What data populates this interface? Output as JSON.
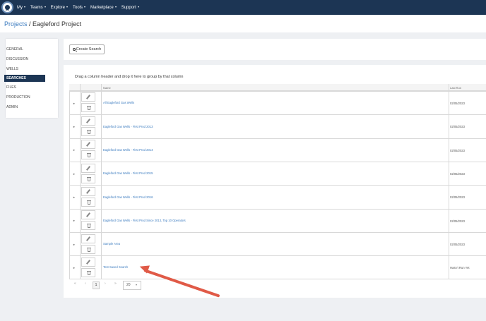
{
  "nav": {
    "logo_text": "BIG",
    "items": [
      "My",
      "Teams",
      "Explore",
      "Tools",
      "Marketplace",
      "Support"
    ]
  },
  "breadcrumb": {
    "link": "Projects",
    "separator": " / ",
    "title": "Eagleford Project"
  },
  "sidebar": {
    "items": [
      "GENERAL",
      "DISCUSSION",
      "WELLS",
      "SEARCHES",
      "FILES",
      "PRODUCTION",
      "ADMIN"
    ],
    "active": "SEARCHES"
  },
  "toolbar": {
    "create_label": "Create Search"
  },
  "grid": {
    "group_hint": "Drag a column header and drop it here to group by that column",
    "columns": [
      "Name",
      "Last Run"
    ],
    "rows": [
      {
        "name": "All Eagleford Gas Wells",
        "last_run": "02/05/2023"
      },
      {
        "name": "Eagleford Gas Wells - First Prod 2013",
        "last_run": "02/05/2023"
      },
      {
        "name": "Eagleford Gas Wells - First Prod 2014",
        "last_run": "02/05/2023"
      },
      {
        "name": "Eagleford Gas Wells - First Prod 2015",
        "last_run": "02/05/2023"
      },
      {
        "name": "Eagleford Gas Wells - First Prod 2016",
        "last_run": "02/05/2023"
      },
      {
        "name": "Eagleford Gas Wells - First Prod Since 2013, Top 10 Operators",
        "last_run": "02/05/2023"
      },
      {
        "name": "Sample Area",
        "last_run": "02/05/2023"
      },
      {
        "name": "Test Saved Search",
        "last_run": "Hasn't Run Yet"
      }
    ]
  },
  "pager": {
    "first": "«",
    "prev": "‹",
    "page": "1",
    "next": "›",
    "last": "»",
    "page_size": "20"
  },
  "colors": {
    "navbar": "#1c3554",
    "link": "#3b7bbf",
    "annotation_arrow": "#e05a47"
  },
  "icons": {
    "edit": "pencil-icon",
    "delete": "trash-icon",
    "search": "search-icon",
    "expand": "expand-arrow-icon"
  }
}
